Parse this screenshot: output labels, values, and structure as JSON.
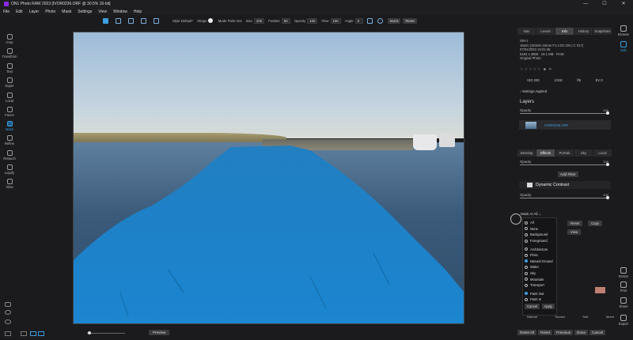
{
  "app": {
    "title": "ON1 Photo RAW 2023 [IVOR0236.ORF @ 30.5% 16-bit]",
    "min": "—",
    "max": "☐",
    "close": "✕"
  },
  "menu": [
    "File",
    "Edit",
    "Layer",
    "Photo",
    "Mask",
    "Settings",
    "View",
    "Window",
    "Help"
  ],
  "toolbar": {
    "style_label": "Style",
    "style_value": "Default*",
    "shape_label": "Shape",
    "mode_label": "Mode",
    "mode_value": "Paint Out",
    "size_label": "Size",
    "size_value": "200",
    "feather_label": "Feather",
    "feather_value": "80",
    "opacity_label": "Opacity",
    "opacity_value": "100",
    "flow_label": "Flow",
    "flow_value": "100",
    "angle_label": "Angle",
    "angle_value": "0",
    "invert": "Invert",
    "reset": "Reset"
  },
  "left_tools": [
    "Crop",
    "Transform",
    "Text",
    "Super",
    "Local",
    "Faces",
    "Mask",
    "Refine",
    "Retouch",
    "Liquify",
    "View"
  ],
  "right_strip": [
    "Browse",
    "Edit",
    "Resize",
    "Print",
    "Share",
    "Export"
  ],
  "info_tabs": [
    "Nav",
    "Levels",
    "Info",
    "History",
    "Snapshots"
  ],
  "info_lines": [
    "OM-1",
    "16mm (SIGMA 16mm F1.4 DC DN | C 017)",
    "07/01/2023 15:01:36",
    "5184 x 3888 · 19.1 MB · RAW",
    "Original Photo"
  ],
  "exif": [
    "ISO 200",
    "1/100",
    "f/8",
    "EV 0"
  ],
  "settings_applied": "Settings Applied",
  "layers": {
    "title": "Layers",
    "opacity_label": "Opacity",
    "opacity_value": "100",
    "layer_name": "IVOR0236.ORF"
  },
  "module_tabs": [
    "Develop",
    "Effects",
    "Portrait",
    "Sky",
    "Local"
  ],
  "effects": {
    "opacity_label": "Opacity",
    "opacity_value": "100",
    "add_filter": "Add Filter",
    "filter_name": "Dynamic Contrast",
    "filter_opacity_label": "Opacity",
    "filter_opacity_value": "100"
  },
  "mask_ai": {
    "label": "Mask AI All",
    "reset": "Reset",
    "copy": "Copy",
    "view": "View"
  },
  "dropdown": {
    "groupA": [
      "All",
      "None",
      "Background",
      "Foreground"
    ],
    "groupB": [
      "Architecture",
      "Flora",
      "Natural Ground",
      "Water",
      "Sky",
      "Mountain",
      "Transport"
    ],
    "groupC": [
      "Paint Out",
      "Paint In"
    ],
    "checked": [
      "Natural Ground",
      "Paint Out"
    ],
    "cancel": "Cancel",
    "apply": "Apply"
  },
  "presets": [
    "Natural",
    "Sunset",
    "Soft",
    "Moon"
  ],
  "bottom_buttons": [
    "Reset All",
    "Reset",
    "Previous",
    "Done",
    "Cancel"
  ],
  "preview": "Preview",
  "colors": {
    "accent": "#3b9fe0",
    "mask": "#1d8fd6",
    "swatch": "#c07e74"
  }
}
